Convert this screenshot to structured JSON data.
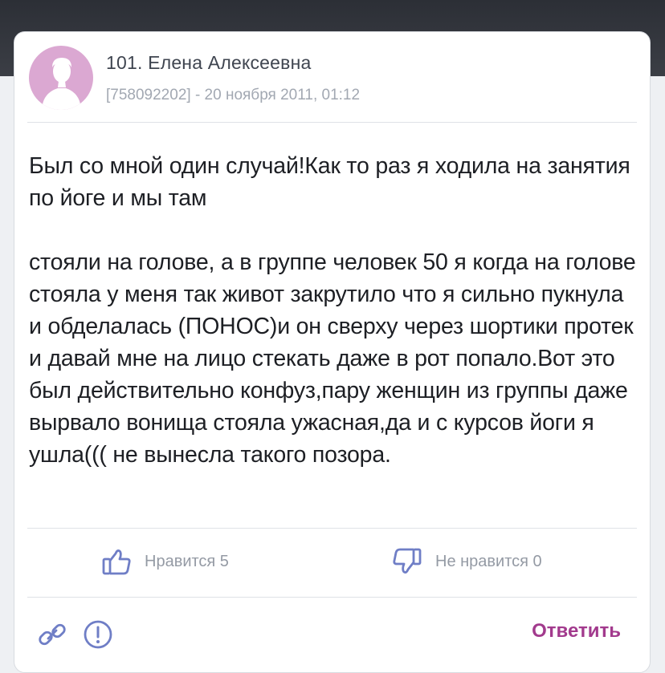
{
  "post": {
    "author": "101. Елена Алексеевна",
    "meta": "[758092202] - 20 ноября 2011, 01:12",
    "paragraphs": [
      "Был со мной один случай!Как то раз я ходила на занятия по йоге и мы там",
      "стояли на голове, а в группе человек 50 я когда на голове стояла у меня так живот закрутило что я сильно пукнула и обделалась (ПОНОС)и он сверху через шортики протек и давай мне на лицо стекать даже в рот попало.Вот это был действительно конфуз,пару женщин из группы даже вырвало вонища стояла ужасная,да и с курсов йоги я ушла((( не вынесла такого позора."
    ]
  },
  "votes": {
    "like_label": "Нравится 5",
    "dislike_label": "Не нравится 0"
  },
  "actions": {
    "reply_label": "Ответить"
  },
  "icons": {
    "avatar": "user-silhouette-icon",
    "like": "thumbs-up-icon",
    "dislike": "thumbs-down-icon",
    "link": "link-icon",
    "report": "exclamation-circle-icon"
  },
  "colors": {
    "accent": "#a23a8d",
    "avatar_bg": "#dba8d2",
    "vote_icon": "#6f7ec6",
    "muted_text": "#949aa4"
  }
}
